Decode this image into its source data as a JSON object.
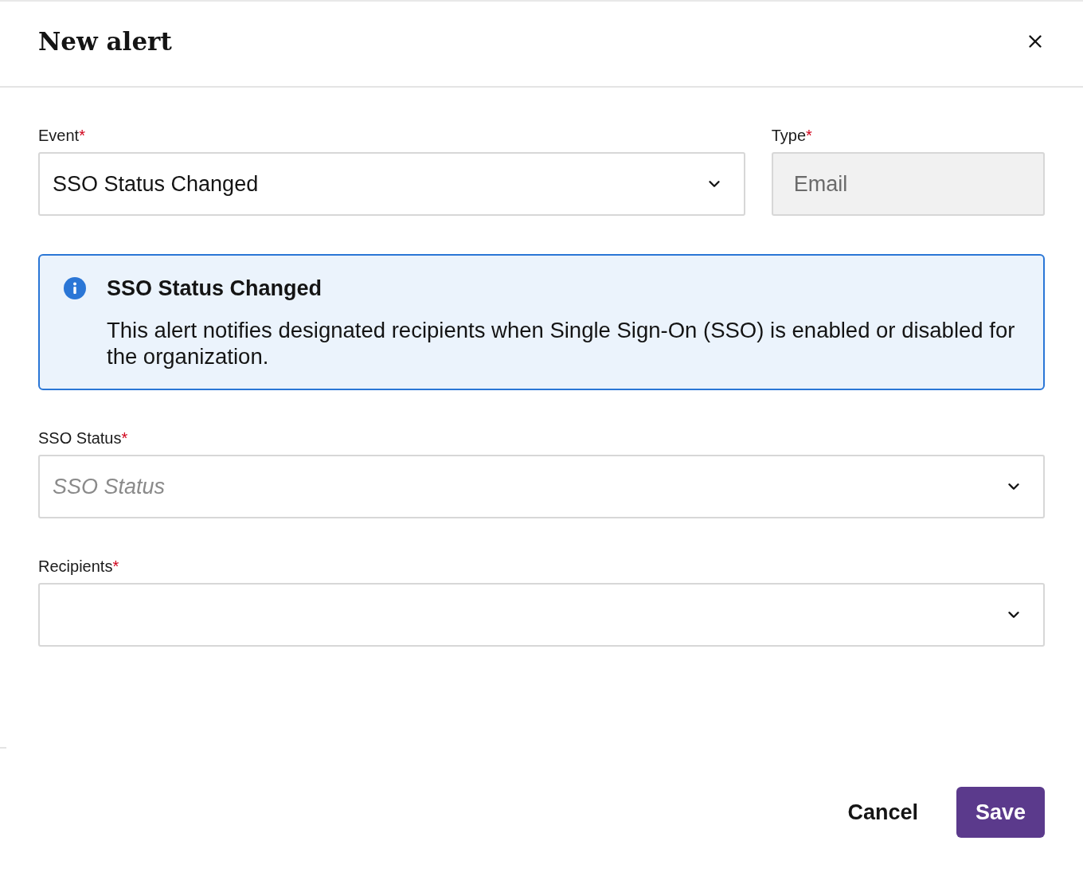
{
  "dialog": {
    "title": "New alert"
  },
  "top_fields": [
    {
      "label": "Event",
      "required_mark": "*",
      "kind": "select",
      "value": "SSO Status Changed",
      "disabled": false
    },
    {
      "label": "Type",
      "required_mark": "*",
      "kind": "text",
      "value": "Email",
      "disabled": true
    }
  ],
  "info_box": {
    "title": "SSO Status Changed",
    "body": "This alert notifies designated recipients when Single Sign-On (SSO) is enabled or disabled for the organization."
  },
  "fields": [
    {
      "label": "SSO Status",
      "required_mark": "*",
      "kind": "select",
      "placeholder": "SSO Status",
      "disabled": false
    },
    {
      "label": "Recipients",
      "required_mark": "*",
      "kind": "select",
      "disabled": false
    }
  ],
  "buttons": [
    {
      "label": "Cancel",
      "kind": "text"
    },
    {
      "label": "Save",
      "kind": "primary"
    }
  ]
}
